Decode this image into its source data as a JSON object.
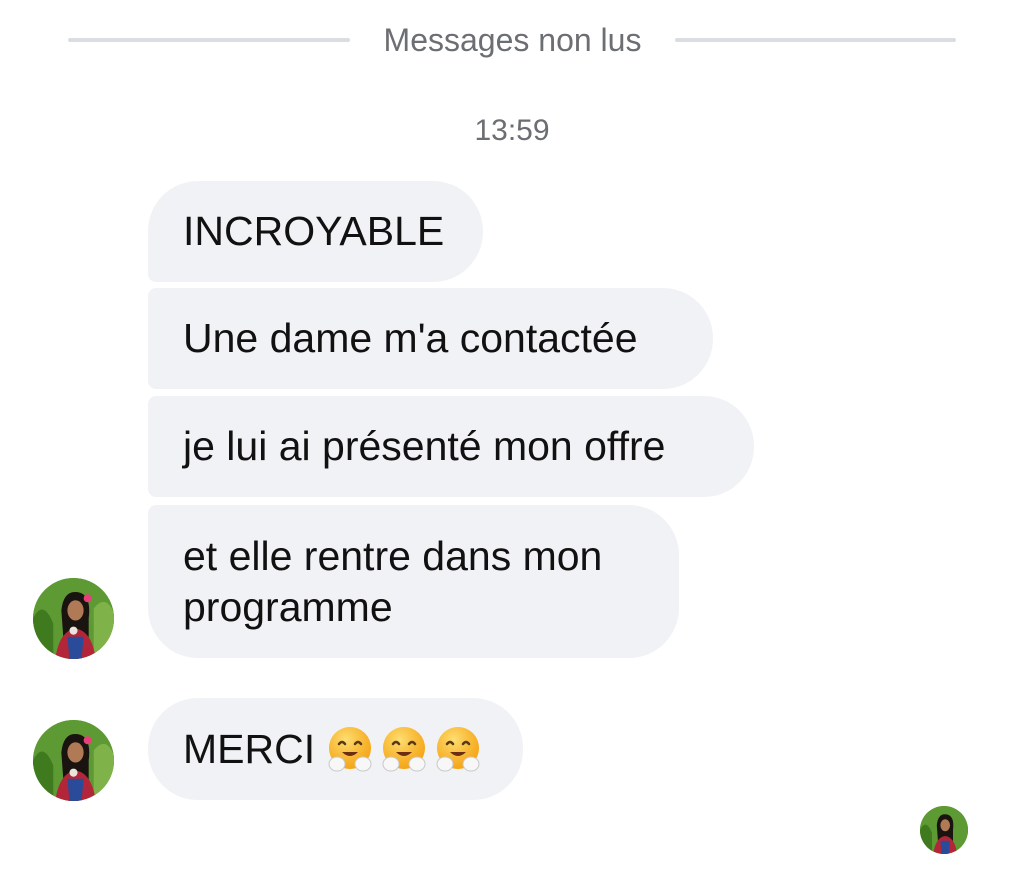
{
  "divider": {
    "label": "Messages non lus"
  },
  "timestamp": "13:59",
  "messages": [
    {
      "text": "INCROYABLE"
    },
    {
      "text": "Une dame m'a contactée"
    },
    {
      "text": "je lui ai présenté mon offre"
    },
    {
      "text": "et elle rentre dans mon\nprogramme"
    },
    {
      "text": "MERCI",
      "emojis": [
        "hugging-face-emoji",
        "hugging-face-emoji",
        "hugging-face-emoji"
      ]
    }
  ],
  "avatars": [
    "sender-avatar",
    "sender-avatar",
    "seen-receipt-avatar"
  ]
}
